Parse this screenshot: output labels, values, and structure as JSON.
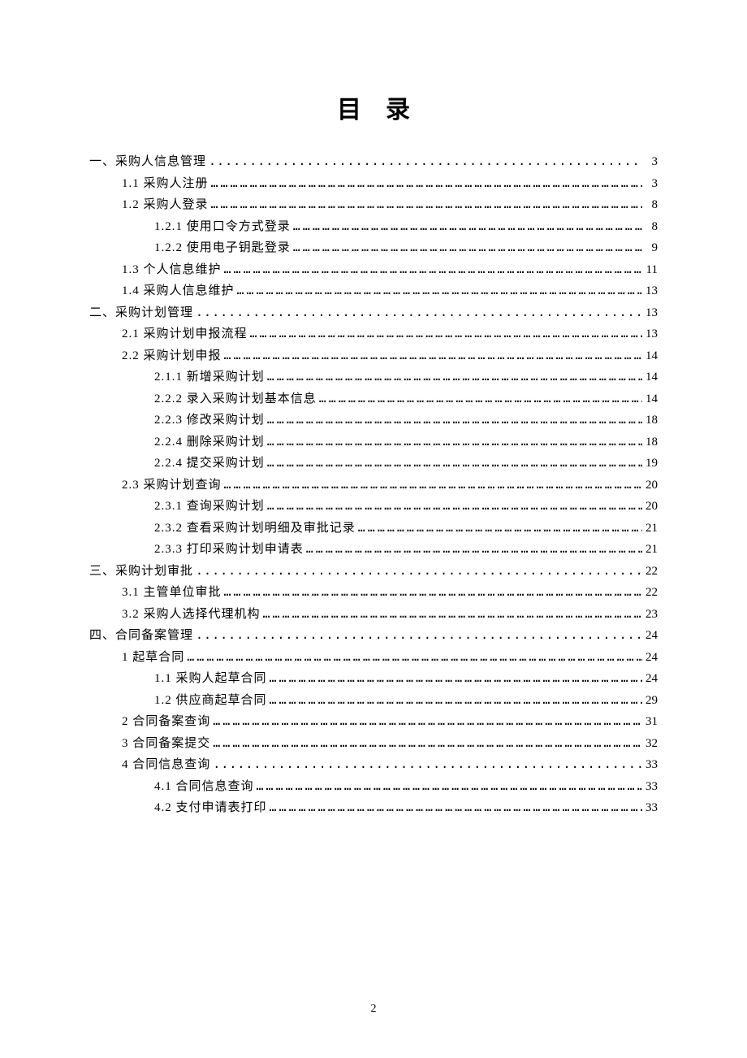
{
  "title": "目录",
  "page_number": "2",
  "toc": [
    {
      "level": 0,
      "label": "一、采购人信息管理",
      "page": "3",
      "leader": "dots"
    },
    {
      "level": 1,
      "label": "1.1 采购人注册",
      "page": "3",
      "leader": "ellipsis"
    },
    {
      "level": 1,
      "label": "1.2 采购人登录",
      "page": "8",
      "leader": "ellipsis"
    },
    {
      "level": 2,
      "label": "1.2.1 使用口令方式登录",
      "page": "8",
      "leader": "ellipsis"
    },
    {
      "level": 2,
      "label": "1.2.2 使用电子钥匙登录",
      "page": "9",
      "leader": "ellipsis"
    },
    {
      "level": 1,
      "label": "1.3 个人信息维护",
      "page": "11",
      "leader": "ellipsis"
    },
    {
      "level": 1,
      "label": "1.4 采购人信息维护",
      "page": "13",
      "leader": "ellipsis"
    },
    {
      "level": 0,
      "label": "二、采购计划管理",
      "page": "13",
      "leader": "dots"
    },
    {
      "level": 1,
      "label": "2.1 采购计划申报流程",
      "page": "13",
      "leader": "ellipsis"
    },
    {
      "level": 1,
      "label": "2.2 采购计划申报",
      "page": "14",
      "leader": "ellipsis"
    },
    {
      "level": 2,
      "label": "2.1.1 新增采购计划",
      "page": "14",
      "leader": "ellipsis"
    },
    {
      "level": 2,
      "label": "2.2.2 录入采购计划基本信息",
      "page": "14",
      "leader": "ellipsis"
    },
    {
      "level": 2,
      "label": "2.2.3 修改采购计划",
      "page": "18",
      "leader": "ellipsis"
    },
    {
      "level": 2,
      "label": "2.2.4 删除采购计划",
      "page": "18",
      "leader": "ellipsis"
    },
    {
      "level": 2,
      "label": "2.2.4 提交采购计划",
      "page": "19",
      "leader": "ellipsis"
    },
    {
      "level": 1,
      "label": "2.3 采购计划查询",
      "page": "20",
      "leader": "ellipsis"
    },
    {
      "level": 2,
      "label": "2.3.1 查询采购计划",
      "page": "20",
      "leader": "ellipsis"
    },
    {
      "level": 2,
      "label": "2.3.2 查看采购计划明细及审批记录",
      "page": "21",
      "leader": "ellipsis"
    },
    {
      "level": 2,
      "label": "2.3.3 打印采购计划申请表",
      "page": "21",
      "leader": "ellipsis"
    },
    {
      "level": 0,
      "label": "三、采购计划审批",
      "page": "22",
      "leader": "dots"
    },
    {
      "level": 1,
      "label": "3.1 主管单位审批",
      "page": "22",
      "leader": "ellipsis"
    },
    {
      "level": 1,
      "label": "3.2 采购人选择代理机构",
      "page": "23",
      "leader": "ellipsis"
    },
    {
      "level": 0,
      "label": "四、合同备案管理",
      "page": "24",
      "leader": "dots"
    },
    {
      "level": 1,
      "label": "1 起草合同",
      "page": "24",
      "leader": "ellipsis"
    },
    {
      "level": 2,
      "label": "1.1 采购人起草合同",
      "page": "24",
      "leader": "ellipsis"
    },
    {
      "level": 2,
      "label": "1.2 供应商起草合同",
      "page": "29",
      "leader": "ellipsis"
    },
    {
      "level": 1,
      "label": "2 合同备案查询",
      "page": "31",
      "leader": "ellipsis"
    },
    {
      "level": 1,
      "label": "3 合同备案提交",
      "page": "32",
      "leader": "ellipsis"
    },
    {
      "level": 1,
      "label": "4  合同信息查询",
      "page": "33",
      "leader": "dots"
    },
    {
      "level": 2,
      "label": "4.1 合同信息查询",
      "page": "33",
      "leader": "ellipsis"
    },
    {
      "level": 2,
      "label": "4.2 支付申请表打印",
      "page": "33",
      "leader": "ellipsis"
    }
  ]
}
